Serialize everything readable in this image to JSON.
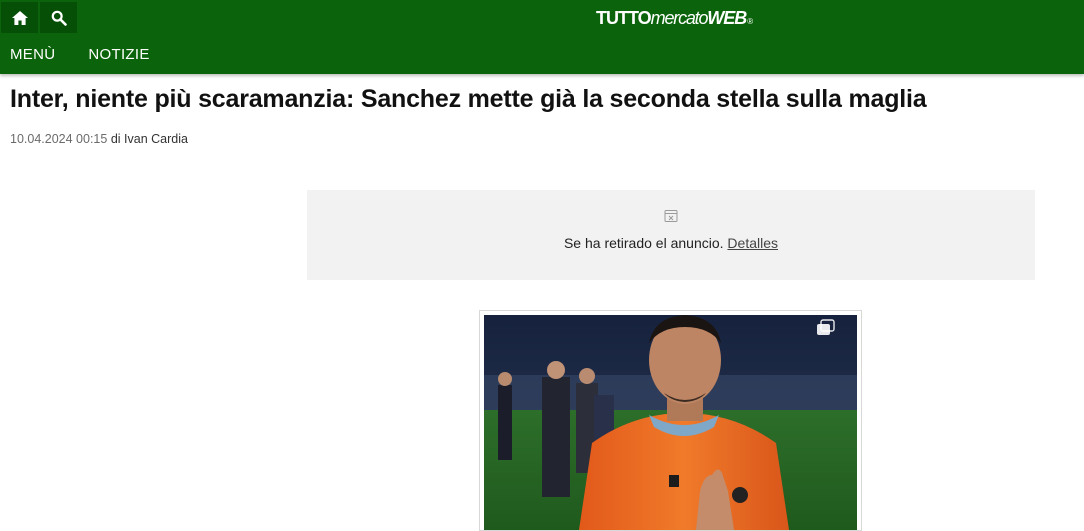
{
  "header": {
    "icons": [
      "home-icon",
      "search-icon"
    ],
    "logo": {
      "part1": "TUTTO",
      "part2": "mercato",
      "part3": "WEB",
      "reg": "®"
    },
    "nav": [
      {
        "label": "MENÙ"
      },
      {
        "label": "NOTIZIE"
      }
    ],
    "bg_color": "#0b640b",
    "button_color": "#064f06"
  },
  "article": {
    "title": "Inter, niente più scaramanzia: Sanchez mette già la seconda stella sulla maglia",
    "date": "10.04.2024 00:15",
    "by": "di",
    "author": "Ivan Cardia"
  },
  "ad": {
    "icon": "ad-removed-icon",
    "message": "Se ha retirado el anuncio.",
    "link_label": "Detalles",
    "bg_color": "#f2f2f2"
  },
  "photo": {
    "icon": "copy-icon",
    "description_colors": {
      "jersey": "#e8641b",
      "pitch": "#2f7a2a",
      "stands": "#1c2a45"
    }
  }
}
